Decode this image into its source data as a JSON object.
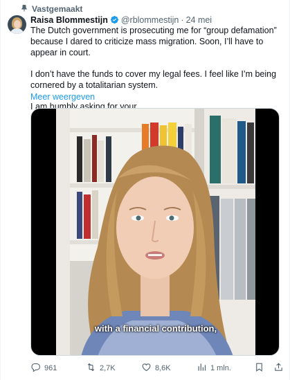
{
  "pinned": {
    "label": "Vastgemaakt",
    "icon": "pin-icon"
  },
  "author": {
    "name": "Raisa Blommestijn",
    "handle": "@rblommestijn",
    "separator": "·",
    "date": "24 mei",
    "verified": true
  },
  "tweet": {
    "paragraphs": [
      "The Dutch government is prosecuting me for “group defamation” because I dared to criticize mass migration. Soon, I’ll have to appear in court.",
      "I don’t have the funds to cover my legal fees. I feel like I’m being cornered by a totalitarian system.",
      "I am humbly asking for your"
    ],
    "show_more": "Meer weergeven"
  },
  "media": {
    "subtitle": "with a financial contribution,"
  },
  "actions": {
    "replies": "961",
    "retweets": "2,7K",
    "likes": "8,6K",
    "views": "1 mln."
  },
  "colors": {
    "accent": "#1d9bf0",
    "text": "#0f1419",
    "muted": "#536471",
    "verified": "#1d9bf0"
  }
}
